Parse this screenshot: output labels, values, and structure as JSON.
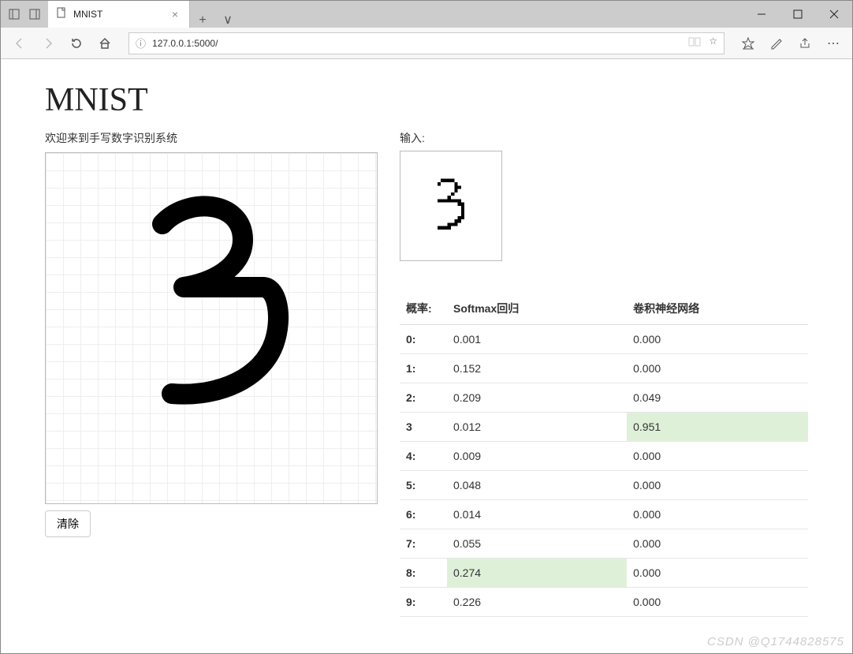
{
  "browser": {
    "tab_title": "MNIST",
    "url": "127.0.0.1:5000/",
    "new_tab_glyph": "+",
    "tab_chevron_glyph": "∨"
  },
  "page": {
    "heading": "MNIST",
    "subtitle": "欢迎来到手写数字识别系统",
    "clear_button": "清除",
    "input_label": "输入:"
  },
  "table": {
    "headers": {
      "prob": "概率:",
      "softmax": "Softmax回归",
      "cnn": "卷积神经网络"
    },
    "rows": [
      {
        "label": "0:",
        "softmax": "0.001",
        "cnn": "0.000"
      },
      {
        "label": "1:",
        "softmax": "0.152",
        "cnn": "0.000"
      },
      {
        "label": "2:",
        "softmax": "0.209",
        "cnn": "0.049"
      },
      {
        "label": "3",
        "softmax": "0.012",
        "cnn": "0.951",
        "cnn_hl": true
      },
      {
        "label": "4:",
        "softmax": "0.009",
        "cnn": "0.000"
      },
      {
        "label": "5:",
        "softmax": "0.048",
        "cnn": "0.000"
      },
      {
        "label": "6:",
        "softmax": "0.014",
        "cnn": "0.000"
      },
      {
        "label": "7:",
        "softmax": "0.055",
        "cnn": "0.000"
      },
      {
        "label": "8:",
        "softmax": "0.274",
        "cnn": "0.000",
        "softmax_hl": true
      },
      {
        "label": "9:",
        "softmax": "0.226",
        "cnn": "0.000"
      }
    ]
  },
  "watermark": "CSDN @Q1744828575"
}
